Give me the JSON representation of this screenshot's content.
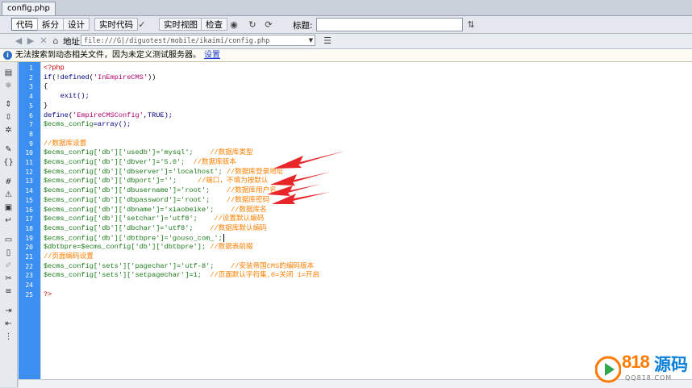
{
  "document_tab": "config.php",
  "toolbar": {
    "code": "代码",
    "split": "拆分",
    "design": "设计",
    "live_code": "实时代码",
    "live_view": "实时视图",
    "check": "检查",
    "title_label": "标题:"
  },
  "address": {
    "label": "地址:",
    "value": "file:///G|/diguotest/mobile/ikaimi/config.php"
  },
  "infobar": {
    "message": "无法搜索到动态相关文件，因为未定义测试服务器。",
    "link": "设置"
  },
  "line_numbers": [
    "1",
    "2",
    "3",
    "4",
    "5",
    "6",
    "7",
    "8",
    "9",
    "10",
    "11",
    "12",
    "13",
    "14",
    "15",
    "16",
    "17",
    "18",
    "19",
    "20",
    "21",
    "22",
    "23",
    "24",
    "25"
  ],
  "code": {
    "l1": "<?php",
    "l2_kw": "if",
    "l2_a": "(!",
    "l2_fn": "defined",
    "l2_b": "(",
    "l2_str": "'InEmpireCMS'",
    "l2_c": "))",
    "l3": "{",
    "l4": "    exit();",
    "l5": "}",
    "l6_fn": "define",
    "l6_a": "(",
    "l6_str": "'EmpireCMSConfig'",
    "l6_b": ",TRUE);",
    "l7_var": "$ecms_config",
    "l7_rest": "=array();",
    "l9": "//数据库设置",
    "l10_a": "$ecms_config['db']['usedb']='mysql';",
    "l10_c": "    //数据库类型",
    "l11_a": "$ecms_config['db']['dbver']='5.0';",
    "l11_c": "  //数据库版本",
    "l12_a": "$ecms_config['db']['dbserver']='localhost';",
    "l12_c": " //数据库登录地址",
    "l13_a": "$ecms_config['db']['dbport']='';",
    "l13_c": "     //端口，不填为按默认",
    "l14_a": "$ecms_config['db']['dbusername']='root';",
    "l14_c": "    //数据库用户名",
    "l15_a": "$ecms_config['db']['dbpassword']='root';",
    "l15_c": "    //数据库密码",
    "l16_a": "$ecms_config['db']['dbname']='xiaobeike';",
    "l16_c": "    //数据库名",
    "l17_a": "$ecms_config['db']['setchar']='utf8';",
    "l17_c": "    //设置默认编码",
    "l18_a": "$ecms_config['db']['dbchar']='utf8';",
    "l18_c": "    //数据库默认编码",
    "l19_a": "$ecms_config['db']['dbtbpre']='gouso_com_';",
    "l20_a": "$dbtbpre=$ecms_config['db']['dbtbpre'];",
    "l20_c": " //数据表前缀",
    "l21": "//页面编码设置",
    "l22_a": "$ecms_config['sets']['pagechar']='utf-8';",
    "l22_c": "    //安装帝国CMS的编码版本",
    "l23_a": "$ecms_config['sets']['setpagechar']=1;",
    "l23_c": "  //页面默认字符集,0=关闭 1=开启",
    "l25": "?>"
  },
  "watermark": {
    "number": "818",
    "name": "源码",
    "url": "QQ818.COM"
  },
  "colors": {
    "gutter": "#3a8ff0",
    "keyword": "#000080",
    "variable": "#1a7a1a",
    "string": "#b0006a",
    "comment": "#ff7f00",
    "php_tag": "#cc0000",
    "annotation_arrow": "#e8262a"
  }
}
